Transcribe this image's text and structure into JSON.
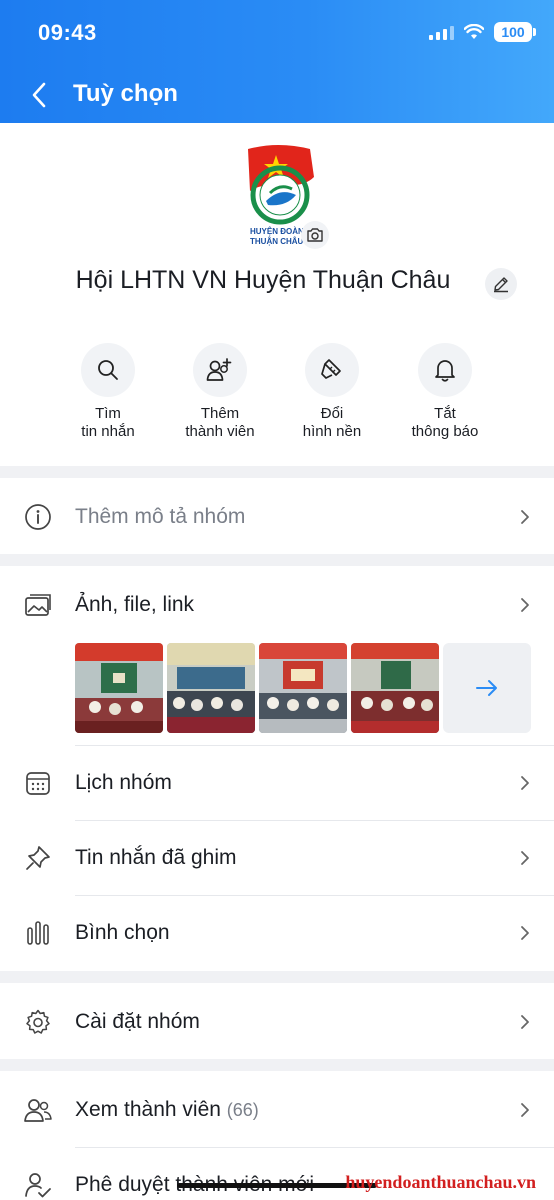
{
  "status_bar": {
    "time": "09:43",
    "battery": "100"
  },
  "header": {
    "title": "Tuỳ chọn"
  },
  "group": {
    "name": "Hội LHTN VN Huyện Thuận Châu",
    "avatar_text_1": "HUYỆN ĐOÀN",
    "avatar_text_2": "THUẬN CHÂU"
  },
  "actions": [
    {
      "line1": "Tìm",
      "line2": "tin nhắn",
      "icon": "search-icon"
    },
    {
      "line1": "Thêm",
      "line2": "thành viên",
      "icon": "add-member-icon"
    },
    {
      "line1": "Đổi",
      "line2": "hình nền",
      "icon": "paint-brush-icon"
    },
    {
      "line1": "Tắt",
      "line2": "thông báo",
      "icon": "bell-icon"
    }
  ],
  "rows": {
    "description": "Thêm mô tả nhóm",
    "media": "Ảnh, file, link",
    "calendar": "Lịch nhóm",
    "pinned": "Tin nhắn đã ghim",
    "poll": "Bình chọn",
    "settings": "Cài đặt nhóm",
    "members": "Xem thành viên",
    "members_count": "(66)",
    "approve": "Phê duyệt thành viên mới"
  },
  "watermark": "huyendoanthuanchau.vn",
  "colors": {
    "header_start": "#1d7cf0",
    "header_end": "#43a8fb",
    "accent": "#2a8cf5"
  }
}
